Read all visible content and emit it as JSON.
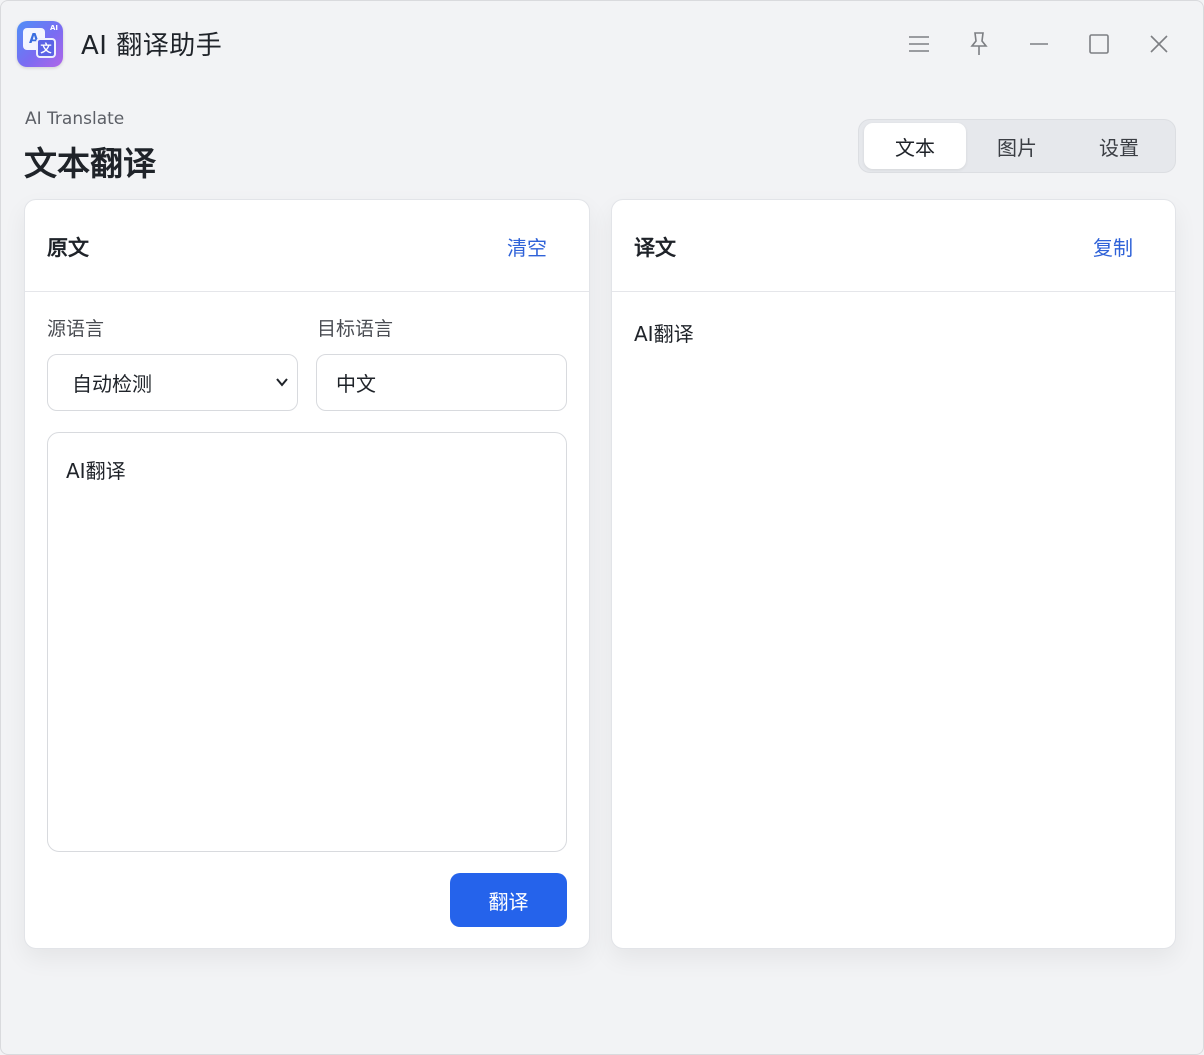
{
  "window": {
    "title": "AI 翻译助手",
    "logo": {
      "letter_a": "A",
      "letter_zh": "文",
      "ai_mark": "AI"
    }
  },
  "header": {
    "subtitle": "AI Translate",
    "title": "文本翻译"
  },
  "tabs": [
    {
      "label": "文本",
      "active": true
    },
    {
      "label": "图片",
      "active": false
    },
    {
      "label": "设置",
      "active": false
    }
  ],
  "source_panel": {
    "title": "原文",
    "clear_label": "清空",
    "source_lang_label": "源语言",
    "target_lang_label": "目标语言",
    "source_lang_value": "自动检测",
    "target_lang_value": "中文",
    "input_text": "AI翻译",
    "translate_label": "翻译"
  },
  "result_panel": {
    "title": "译文",
    "copy_label": "复制",
    "output_text": "AI翻译"
  },
  "colors": {
    "accent": "#2563eb",
    "link": "#2f62d8",
    "background": "#f2f3f5"
  }
}
